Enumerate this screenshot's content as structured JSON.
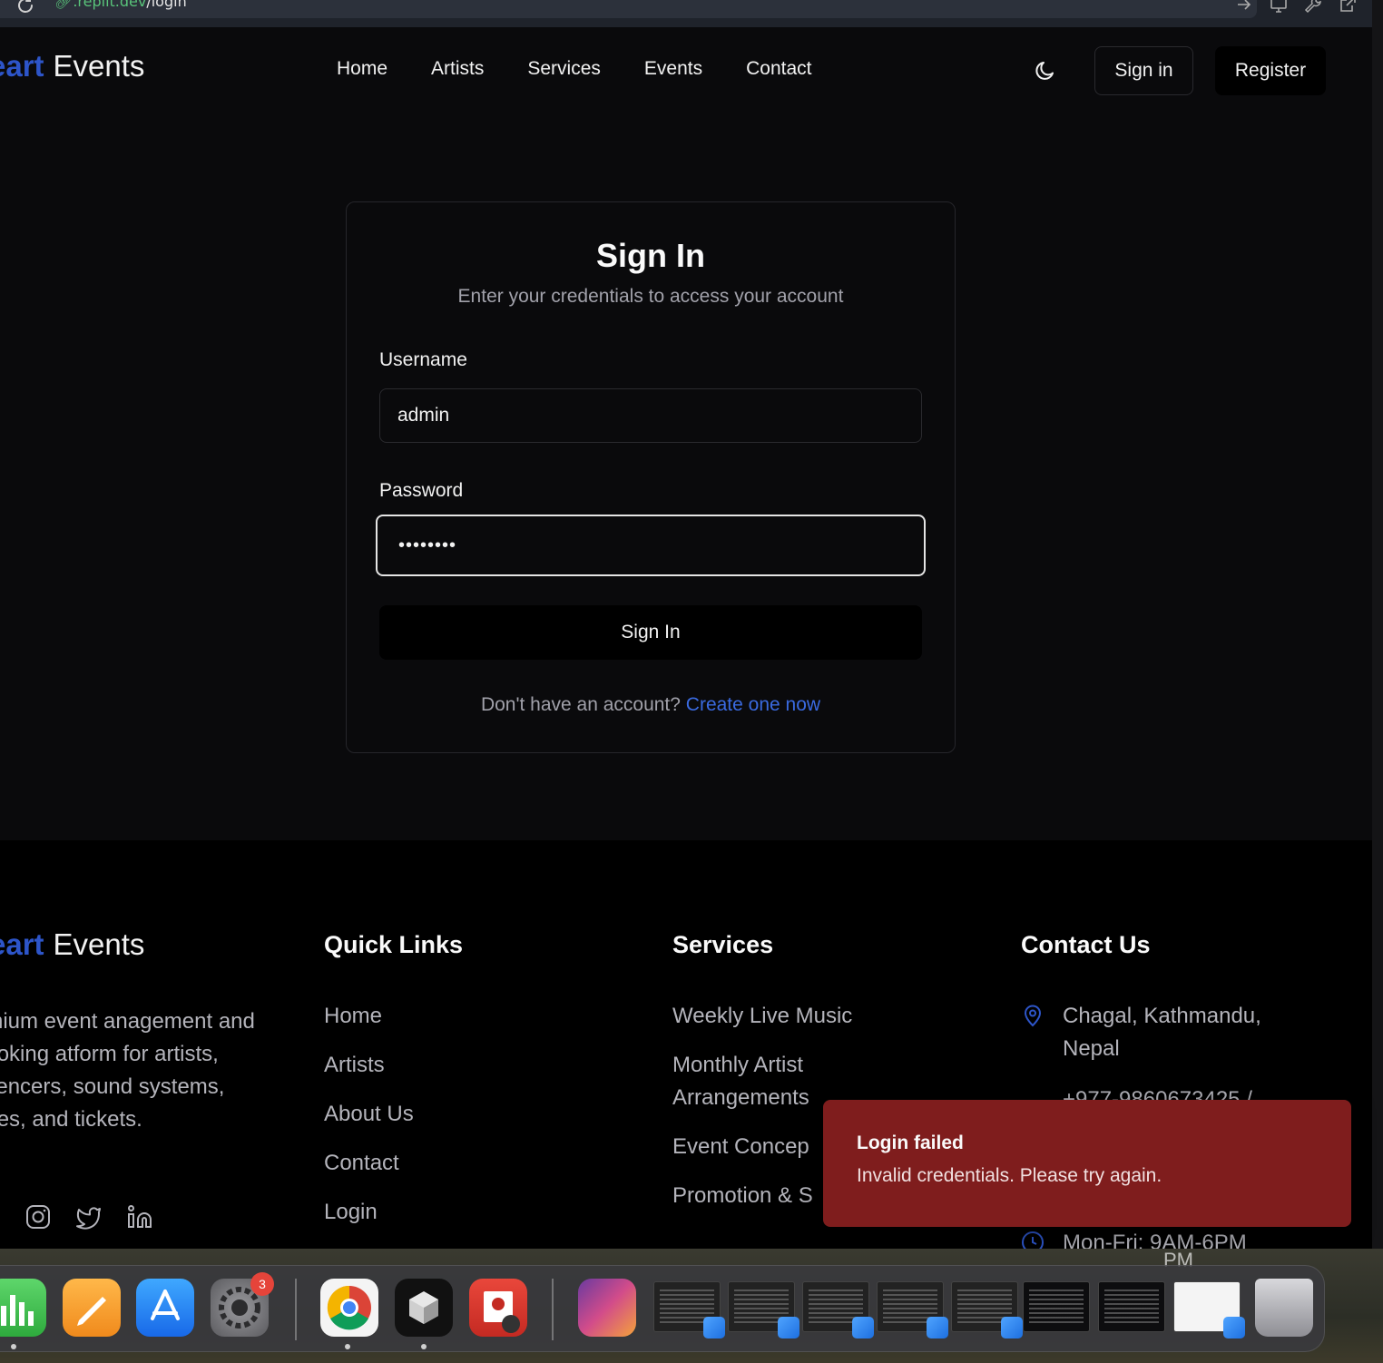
{
  "browser": {
    "url_prefix": ".replit.dev",
    "url_path": "/login"
  },
  "nav": {
    "brand_accent": "eart",
    "brand_main": "Events",
    "links": [
      "Home",
      "Artists",
      "Services",
      "Events",
      "Contact"
    ],
    "sign_in": "Sign in",
    "register": "Register"
  },
  "login": {
    "title": "Sign In",
    "subtitle": "Enter your credentials to access your account",
    "username_label": "Username",
    "username_value": "admin",
    "password_label": "Password",
    "password_value": "••••••••",
    "submit": "Sign In",
    "prompt": "Don't have an account?",
    "prompt_link": "Create one now"
  },
  "footer": {
    "brand_accent": "eart",
    "brand_main": "Events",
    "description": "emium event anagement and booking atform for artists, fluencers, sound systems, nues, and tickets.",
    "quick_links_heading": "Quick Links",
    "quick_links": [
      "Home",
      "Artists",
      "About Us",
      "Contact",
      "Login"
    ],
    "services_heading": "Services",
    "services": [
      "Weekly Live Music",
      "Monthly Artist Arrangements",
      "Event Concep",
      "Promotion & S"
    ],
    "contact_heading": "Contact Us",
    "address": "Chagal, Kathmandu, Nepal",
    "phone_partial": "+977-9860673425 /",
    "hours": "Mon-Fri: 9AM-6PM"
  },
  "toast": {
    "title": "Login failed",
    "message": "Invalid credentials. Please try again."
  },
  "dock": {
    "badge": "3",
    "clock_partial": "PM"
  },
  "colors": {
    "accent": "#2d55c9",
    "link": "#3a6ae0",
    "toast": "#7f1d1d",
    "background": "#0a0a0c"
  }
}
